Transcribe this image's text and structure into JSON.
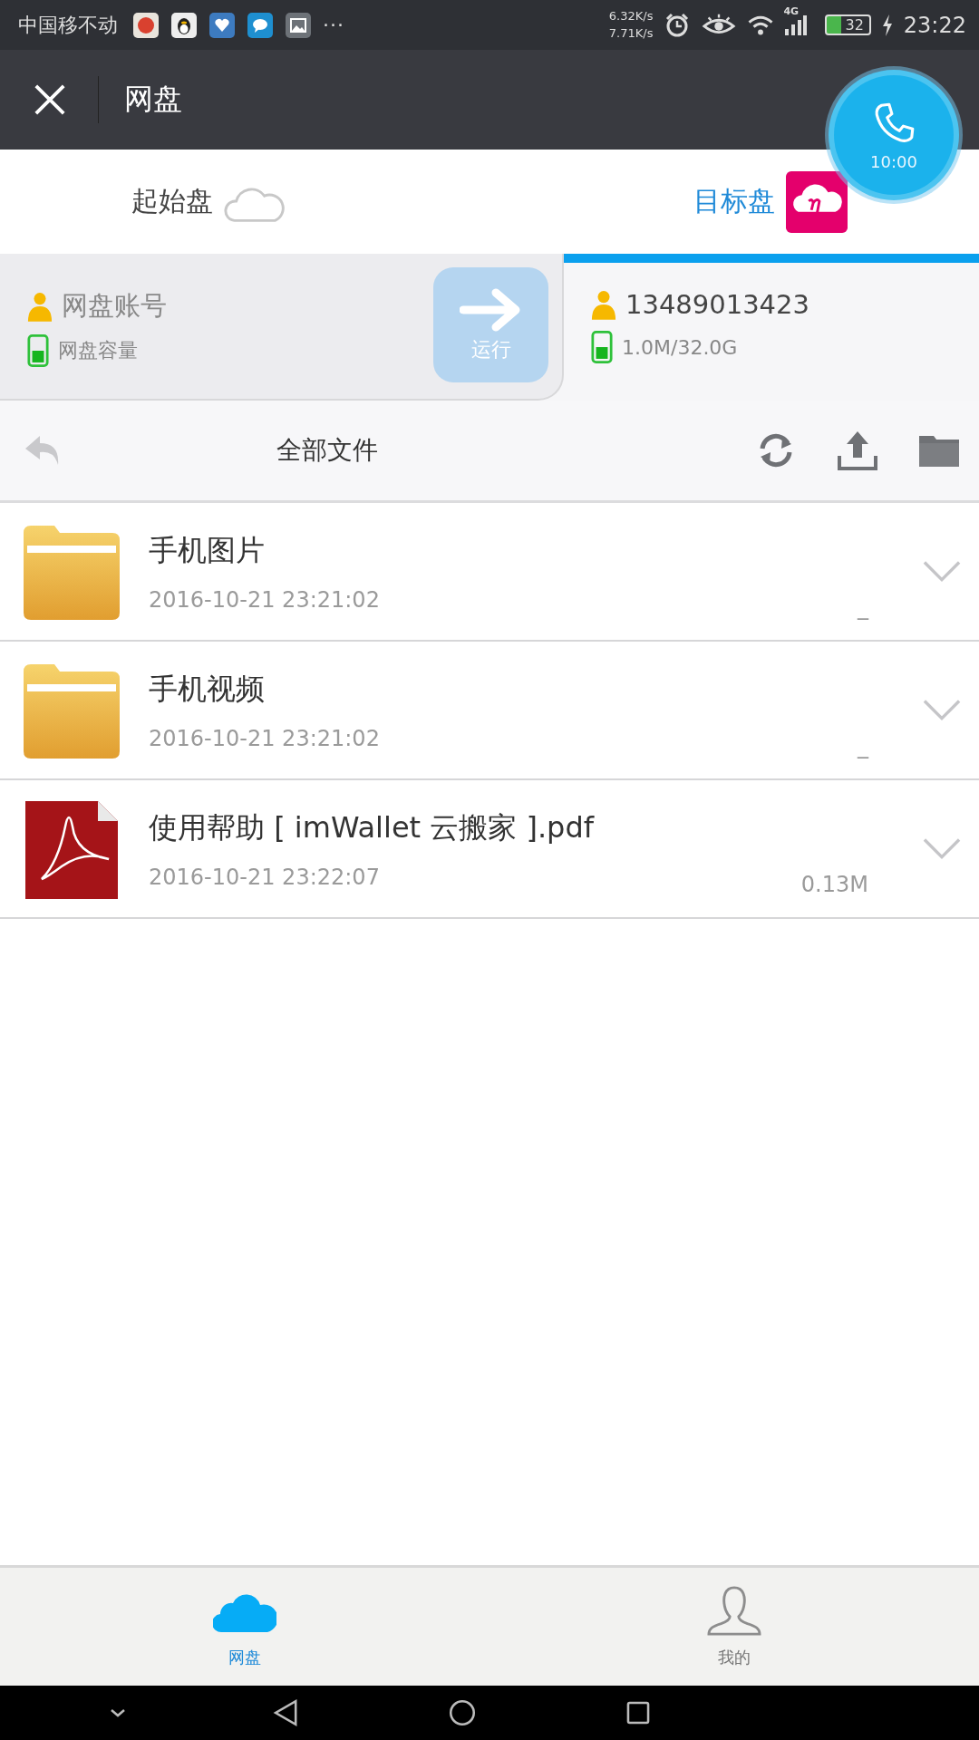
{
  "status_bar": {
    "carrier": "中国移不动",
    "more": "···",
    "speeds": [
      "6.32K/s",
      "7.71K/s"
    ],
    "network": "4G",
    "battery": "32",
    "time": "23:22"
  },
  "header": {
    "title": "网盘"
  },
  "call_bubble": {
    "time": "10:00"
  },
  "disks": [
    {
      "label": "起始盘",
      "selected": false
    },
    {
      "label": "目标盘",
      "selected": true
    }
  ],
  "accounts": [
    {
      "account": "网盘账号",
      "capacity": "网盘容量",
      "selected": false
    },
    {
      "account": "13489013423",
      "capacity": "1.0M/32.0G",
      "selected": true
    }
  ],
  "run_button": {
    "label": "运行",
    "disabled": true
  },
  "toolbar": {
    "title": "全部文件"
  },
  "files": [
    {
      "kind": "folder",
      "name": "手机图片",
      "date": "2016-10-21 23:21:02",
      "size": "_"
    },
    {
      "kind": "folder",
      "name": "手机视频",
      "date": "2016-10-21 23:21:02",
      "size": "_"
    },
    {
      "kind": "pdf",
      "name": "使用帮助 [ imWallet 云搬家 ].pdf",
      "date": "2016-10-21 23:22:07",
      "size": "0.13M"
    }
  ],
  "tabs": [
    {
      "label": "网盘",
      "selected": true
    },
    {
      "label": "我的",
      "selected": false
    }
  ]
}
